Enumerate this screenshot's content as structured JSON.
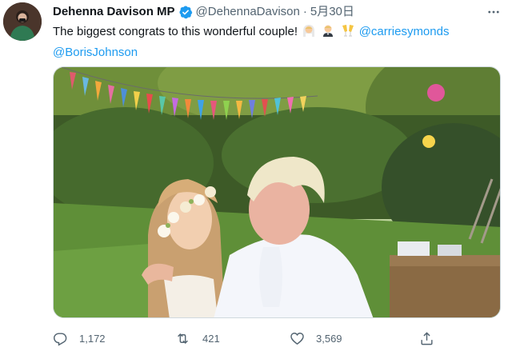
{
  "tweet": {
    "author": {
      "display_name": "Dehenna Davison MP",
      "verified_icon": "verified-badge-icon",
      "handle": "@DehennaDavison",
      "separator": "·",
      "timestamp": "5月30日"
    },
    "text_intro": "The biggest congrats to this wonderful couple!",
    "emojis": [
      "bride-emoji",
      "groom-emoji",
      "clinking-glasses-emoji"
    ],
    "mentions": [
      "@carriesymonds",
      "@BorisJohnson"
    ],
    "actions": {
      "reply_count": "1,172",
      "retweet_count": "421",
      "like_count": "3,569"
    },
    "colors": {
      "link": "#1d9bf0",
      "verified": "#1d9bf0",
      "secondary_text": "#536471"
    }
  }
}
